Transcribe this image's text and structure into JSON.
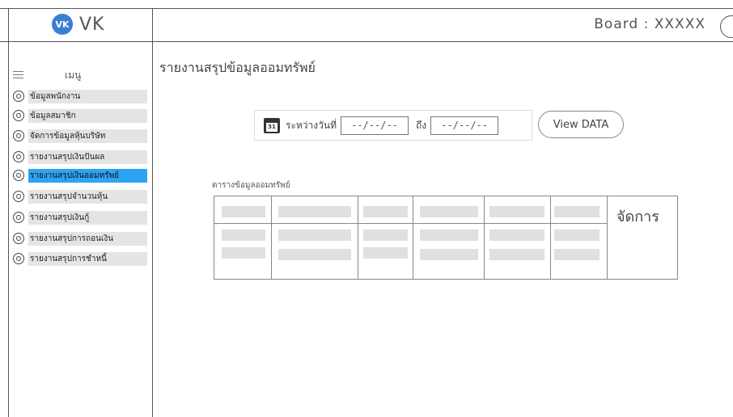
{
  "brand": {
    "logo_text": "VK",
    "name": "VK"
  },
  "board_label": "Board : XXXXX",
  "menu": {
    "title": "เมนู",
    "items": [
      {
        "label": "ข้อมูลพนักงาน",
        "active": false
      },
      {
        "label": "ข้อมูลสมาชิก",
        "active": false
      },
      {
        "label": "จัดการข้อมูลหุ้นบริษัท",
        "active": false
      },
      {
        "label": "รายงานสรุปเงินปันผล",
        "active": false
      },
      {
        "label": "รายงานสรุปเงินออมทรัพย์",
        "active": true
      },
      {
        "label": "รายงานสรุปจำนวนหุ้น",
        "active": false
      },
      {
        "label": "รายงานสรุปเงินกู้",
        "active": false
      },
      {
        "label": "รายงานสรุปการถอนเงิน",
        "active": false
      },
      {
        "label": "รายงานสรุปการชำหนี้",
        "active": false
      }
    ]
  },
  "page": {
    "title": "รายงานสรุปข้อมูลออมทรัพย์"
  },
  "filter": {
    "calendar_day": "31",
    "between_label": "ระหว่างวันที่",
    "from_value": "--/--/--",
    "to_label": "ถึง",
    "to_value": "--/--/--",
    "view_button": "View DATA"
  },
  "table": {
    "caption": "ตารางข้อมูลออมทรัพย์",
    "manage_header": "จัดการ"
  },
  "colors": {
    "active_item": "#2ea3f2",
    "placeholder": "#e0e0e0",
    "logo": "#3b7fd1"
  }
}
